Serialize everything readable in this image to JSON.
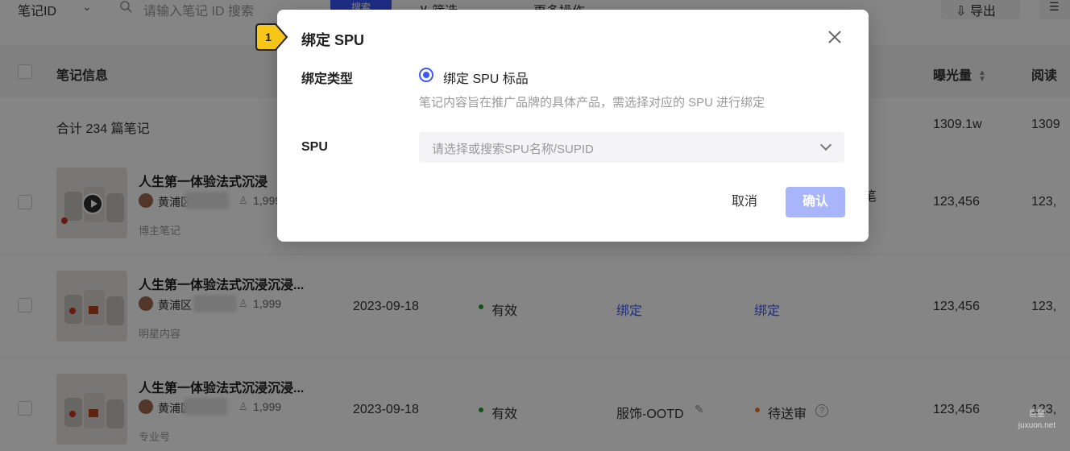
{
  "toolbar": {
    "field_select": "笔记ID",
    "search_placeholder": "请输入笔记 ID 搜索",
    "search_button": "搜索",
    "filter": "筛选",
    "more": "更多操作",
    "export": "导出"
  },
  "table": {
    "headers": {
      "note_info": "笔记信息",
      "exposure": "曝光量",
      "read": "阅读"
    },
    "summary": {
      "label": "合计 234 篇笔记",
      "exposure": "1309.1w",
      "read": "1309"
    },
    "rows": [
      {
        "title": "人生第一体验法式沉浸",
        "author": "黄浦区",
        "fans": "1,999",
        "tag": "博主笔记",
        "partial_text": "笔",
        "exposure": "123,456",
        "read": "123,"
      },
      {
        "title": "人生第一体验法式沉浸沉浸...",
        "author": "黄浦区",
        "fans": "1,999",
        "tag": "明星内容",
        "date": "2023-09-18",
        "status": "有效",
        "status_color": "#1f9d3d",
        "bind1": "绑定",
        "bind2": "绑定",
        "exposure": "123,456",
        "read": "123,"
      },
      {
        "title": "人生第一体验法式沉浸沉浸...",
        "author": "黄浦区",
        "fans": "1,999",
        "tag": "专业号",
        "date": "2023-09-18",
        "status": "有效",
        "status_color": "#1f9d3d",
        "category": "服饰-OOTD",
        "review": "待送审",
        "review_color": "#f27a1a",
        "exposure": "123,456",
        "read": "123,"
      }
    ]
  },
  "modal": {
    "step": "1",
    "title": "绑定 SPU",
    "type_label": "绑定类型",
    "radio_option": "绑定 SPU 标品",
    "hint": "笔记内容旨在推广品牌的具体产品，需选择对应的 SPU 进行绑定",
    "spu_label": "SPU",
    "select_placeholder": "请选择或搜索SPU名称/SUPID",
    "cancel": "取消",
    "confirm": "确认",
    "confirm_color": "#a9b5fa"
  },
  "watermark": {
    "line1": "巨量",
    "line2": "juxuon.net"
  }
}
